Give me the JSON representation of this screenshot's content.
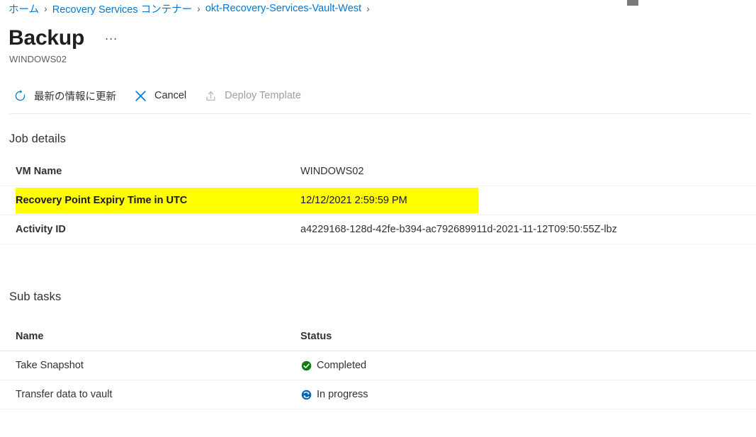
{
  "breadcrumb": {
    "separator": "›",
    "items": [
      {
        "label": "ホーム"
      },
      {
        "label": "Recovery Services コンテナー"
      },
      {
        "label": "okt-Recovery-Services-Vault-West"
      }
    ]
  },
  "header": {
    "title": "Backup",
    "more_label": "…",
    "subtitle": "WINDOWS02"
  },
  "toolbar": {
    "refresh_label": "最新の情報に更新",
    "refresh_icon": "refresh-icon",
    "cancel_label": "Cancel",
    "cancel_icon": "close-icon",
    "deploy_label": "Deploy Template",
    "deploy_icon": "upload-icon",
    "deploy_disabled": true
  },
  "job_details": {
    "heading": "Job details",
    "rows": [
      {
        "name": "VM Name",
        "value": "WINDOWS02",
        "highlighted": false
      },
      {
        "name": "Recovery Point Expiry Time in UTC",
        "value": "12/12/2021 2:59:59 PM",
        "highlighted": true
      },
      {
        "name": "Activity ID",
        "value": "a4229168-128d-42fe-b394-ac792689911d-2021-11-12T09:50:55Z-lbz",
        "highlighted": false
      }
    ]
  },
  "sub_tasks": {
    "heading": "Sub tasks",
    "columns": {
      "name": "Name",
      "status": "Status"
    },
    "rows": [
      {
        "name": "Take Snapshot",
        "status": "Completed",
        "status_icon": "check-circle-icon",
        "status_color": "#107c10"
      },
      {
        "name": "Transfer data to vault",
        "status": "In progress",
        "status_icon": "sync-circle-icon",
        "status_color": "#0063b1"
      }
    ]
  },
  "colors": {
    "link": "#0078d4",
    "highlight": "#ffff00",
    "success": "#107c10",
    "in_progress": "#0063b1",
    "disabled_text": "#a19f9d"
  }
}
